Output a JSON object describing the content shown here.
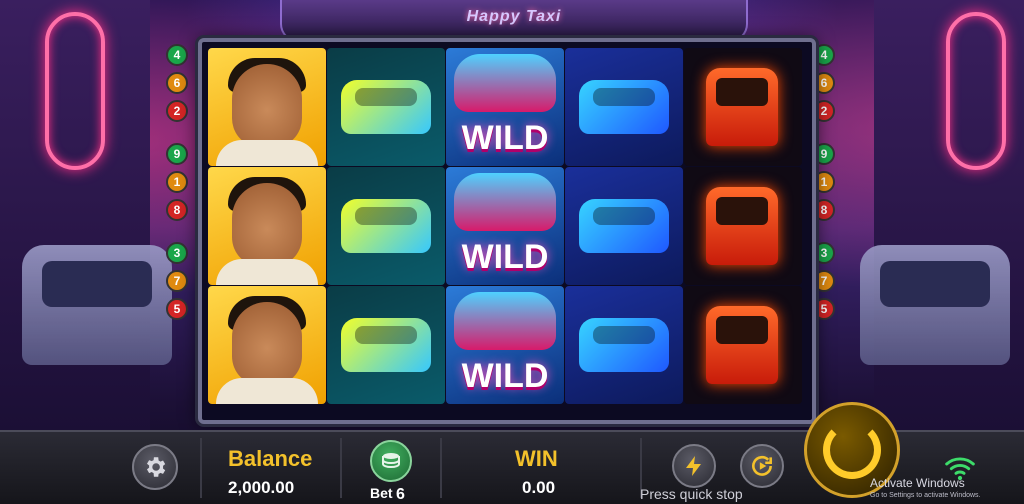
{
  "game": {
    "title": "Happy Taxi"
  },
  "reels": {
    "rows": [
      [
        "man",
        "yellow-taxi",
        "wild",
        "blue-taxi",
        "red-tuktuk"
      ],
      [
        "man",
        "yellow-taxi",
        "wild",
        "blue-taxi",
        "red-tuktuk"
      ],
      [
        "man",
        "yellow-taxi",
        "wild",
        "blue-taxi",
        "red-tuktuk"
      ]
    ],
    "wild_label": "WILD"
  },
  "paylines": {
    "left": [
      {
        "number": "4",
        "color": "green"
      },
      {
        "number": "6",
        "color": "orange"
      },
      {
        "number": "2",
        "color": "red"
      },
      {
        "number": "9",
        "color": "green"
      },
      {
        "number": "1",
        "color": "orange"
      },
      {
        "number": "8",
        "color": "red"
      },
      {
        "number": "3",
        "color": "green"
      },
      {
        "number": "7",
        "color": "orange"
      },
      {
        "number": "5",
        "color": "red"
      }
    ],
    "right": [
      {
        "number": "4",
        "color": "green"
      },
      {
        "number": "6",
        "color": "orange"
      },
      {
        "number": "2",
        "color": "red"
      },
      {
        "number": "9",
        "color": "green"
      },
      {
        "number": "1",
        "color": "orange"
      },
      {
        "number": "8",
        "color": "red"
      },
      {
        "number": "3",
        "color": "green"
      },
      {
        "number": "7",
        "color": "orange"
      },
      {
        "number": "5",
        "color": "red"
      }
    ]
  },
  "hud": {
    "balance_label": "Balance",
    "balance_value": "2,000.00",
    "bet_label": "Bet",
    "bet_value": "6",
    "win_label": "WIN",
    "win_value": "0.00",
    "quick_stop": "Press quick stop"
  },
  "overlay": {
    "activate_title": "Activate Windows",
    "activate_subtitle": "Go to Settings to activate Windows."
  },
  "icons": {
    "settings": "gear-icon",
    "bet": "coin-stack-icon",
    "turbo": "lightning-icon",
    "autoplay": "autoplay-icon",
    "spin": "spin-icon",
    "network": "wifi-icon"
  },
  "colors": {
    "accent_gold": "#f3c12b",
    "payline_green": "#1aa64a",
    "payline_orange": "#e08a10",
    "payline_red": "#d32525"
  }
}
